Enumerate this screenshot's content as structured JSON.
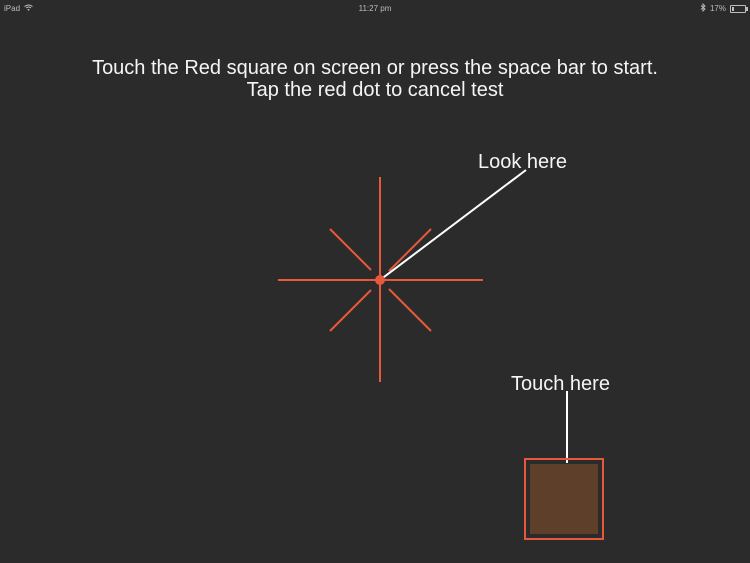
{
  "status_bar": {
    "device": "iPad",
    "time": "11:27 pm",
    "battery_text": "17%",
    "battery_level": 0.17,
    "icons": [
      "wifi-icon",
      "bluetooth-icon",
      "battery-icon"
    ]
  },
  "instructions": {
    "line1": "Touch the Red square on screen or press the space bar to start.",
    "line2": "Tap the red dot to cancel test"
  },
  "labels": {
    "look_here": "Look here",
    "touch_here": "Touch here"
  },
  "colors": {
    "background": "#2b2b2b",
    "accent": "#e8583a",
    "square_fill": "#5e3f2a",
    "pointer": "#ffffff"
  }
}
